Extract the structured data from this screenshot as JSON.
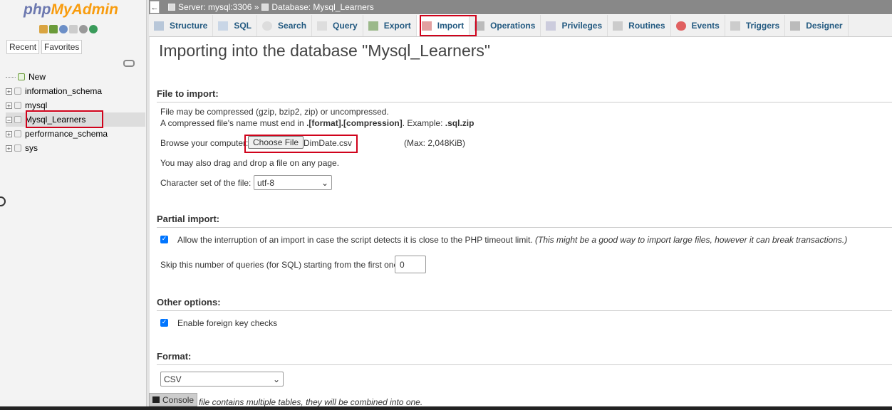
{
  "logo": {
    "php": "php",
    "rest": "MyAdmin"
  },
  "sidebar": {
    "recent_label": "Recent",
    "favorites_label": "Favorites",
    "tree": [
      {
        "label": "New"
      },
      {
        "label": "information_schema"
      },
      {
        "label": "mysql"
      },
      {
        "label": "Mysql_Learners"
      },
      {
        "label": "performance_schema"
      },
      {
        "label": "sys"
      }
    ]
  },
  "breadcrumb": {
    "server": "Server: mysql:3306 »",
    "database": "Database: Mysql_Learners"
  },
  "tabs": [
    {
      "label": "Structure",
      "icon": "structure-icon"
    },
    {
      "label": "SQL",
      "icon": "sql-icon"
    },
    {
      "label": "Search",
      "icon": "search-icon"
    },
    {
      "label": "Query",
      "icon": "query-icon"
    },
    {
      "label": "Export",
      "icon": "export-icon"
    },
    {
      "label": "Import",
      "icon": "import-icon"
    },
    {
      "label": "Operations",
      "icon": "wrench-icon"
    },
    {
      "label": "Privileges",
      "icon": "privileges-icon"
    },
    {
      "label": "Routines",
      "icon": "routines-icon"
    },
    {
      "label": "Events",
      "icon": "clock-icon"
    },
    {
      "label": "Triggers",
      "icon": "triggers-icon"
    },
    {
      "label": "Designer",
      "icon": "designer-icon"
    }
  ],
  "page_title": "Importing into the database \"Mysql_Learners\"",
  "file_import": {
    "title": "File to import:",
    "line1": "File may be compressed (gzip, bzip2, zip) or uncompressed.",
    "line2_prefix": "A compressed file's name must end in ",
    "line2_bold": ".[format].[compression]",
    "line2_mid": ". Example: ",
    "line2_example": ".sql.zip",
    "browse_label": "Browse your computer:",
    "choose_file": "Choose File",
    "file_name": "DimDate.csv",
    "max": "(Max: 2,048KiB)",
    "drag_drop": "You may also drag and drop a file on any page.",
    "charset_label": "Character set of the file:",
    "charset_value": "utf-8"
  },
  "partial_import": {
    "title": "Partial import:",
    "allow_interrupt": "Allow the interruption of an import in case the script detects it is close to the PHP timeout limit.",
    "allow_interrupt_note": "(This might be a good way to import large files, however it can break transactions.)",
    "skip_label": "Skip this number of queries (for SQL) starting from the first one:",
    "skip_value": "0"
  },
  "other_options": {
    "title": "Other options:",
    "foreign_keys": "Enable foreign key checks"
  },
  "format": {
    "title": "Format:",
    "value": "CSV",
    "note": "file contains multiple tables, they will be combined into one."
  },
  "console_label": "Console",
  "colors": {
    "tab_text": "#235a81",
    "highlight": "#d0021b",
    "checkbox": "#0075ff"
  }
}
